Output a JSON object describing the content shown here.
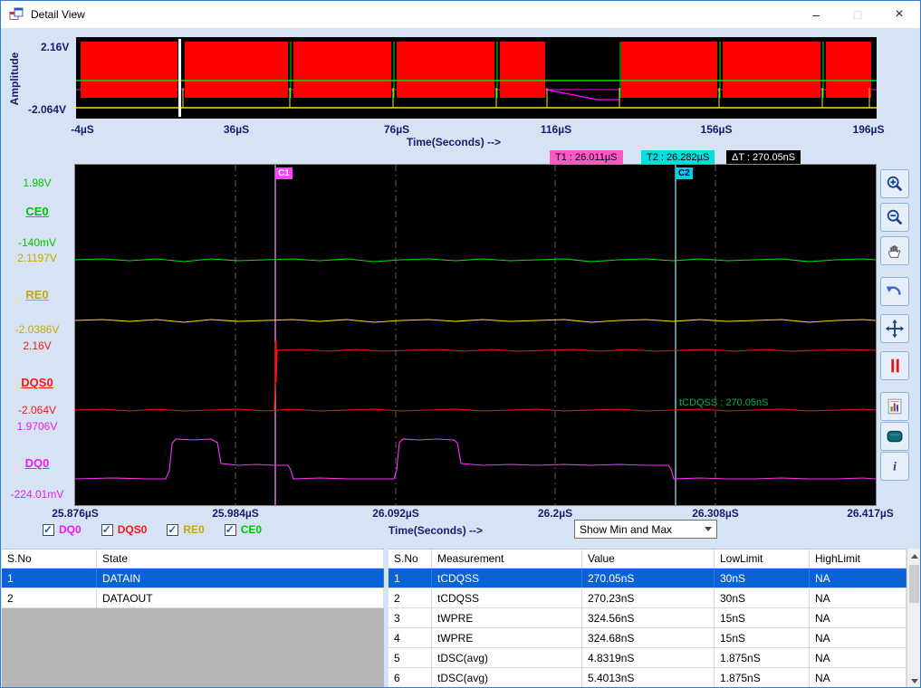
{
  "titlebar": {
    "title": "Detail View",
    "minimize_glyph": "–",
    "maximize_glyph": "□",
    "close_glyph": "×"
  },
  "overview": {
    "ylabel": "Amplitude",
    "y_max": "2.16V",
    "y_min": "-2.064V",
    "xlabel": "Time(Seconds) -->",
    "xticks": [
      "-4µS",
      "36µS",
      "76µS",
      "116µS",
      "156µS",
      "196µS"
    ]
  },
  "detail": {
    "t1": "T1 : 26.011µS",
    "t2": "T2 : 26.282µS",
    "dt": "ΔT : 270.05nS",
    "c1": "C1",
    "c2": "C2",
    "annotation": "tCDQSS : 270.05nS",
    "xlabel": "Time(Seconds) -->",
    "xticks": [
      "25.876µS",
      "25.984µS",
      "26.092µS",
      "26.2µS",
      "26.308µS",
      "26.417µS"
    ],
    "channels": [
      {
        "name": "CE0",
        "max": "1.98V",
        "min": "-140mV",
        "color": "#00e000"
      },
      {
        "name": "RE0",
        "max": "2.1197V",
        "min": "-2.0386V",
        "color": "#ffd800"
      },
      {
        "name": "DQS0",
        "max": "2.16V",
        "min": "-2.064V",
        "color": "#ff1010"
      },
      {
        "name": "DQ0",
        "max": "1.9706V",
        "min": "-224.01mV",
        "color": "#ff00ff"
      }
    ]
  },
  "toolbar": {
    "buttons": [
      "zoom-in",
      "zoom-out",
      "pan",
      "undo",
      "fit-move",
      "cursors",
      "report",
      "display",
      "info"
    ]
  },
  "legend": {
    "items": [
      {
        "label": "DQ0",
        "color": "#ff00ff",
        "checked": true
      },
      {
        "label": "DQS0",
        "color": "#ff1010",
        "checked": true
      },
      {
        "label": "RE0",
        "color": "#c9a900",
        "checked": true
      },
      {
        "label": "CE0",
        "color": "#00c400",
        "checked": true
      }
    ],
    "view_dropdown": "Show Min and Max"
  },
  "state_table": {
    "headers": [
      "S.No",
      "State"
    ],
    "rows": [
      [
        "1",
        "DATAIN"
      ],
      [
        "2",
        "DATAOUT"
      ]
    ],
    "selected_index": 0
  },
  "measurement_table": {
    "headers": [
      "S.No",
      "Measurement",
      "Value",
      "LowLimit",
      "HighLimit"
    ],
    "rows": [
      [
        "1",
        "tCDQSS",
        "270.05nS",
        "30nS",
        "NA"
      ],
      [
        "2",
        "tCDQSS",
        "270.23nS",
        "30nS",
        "NA"
      ],
      [
        "3",
        "tWPRE",
        "324.56nS",
        "15nS",
        "NA"
      ],
      [
        "4",
        "tWPRE",
        "324.68nS",
        "15nS",
        "NA"
      ],
      [
        "5",
        "tDSC(avg)",
        "4.8319nS",
        "1.875nS",
        "NA"
      ],
      [
        "6",
        "tDSC(avg)",
        "5.4013nS",
        "1.875nS",
        "NA"
      ]
    ],
    "selected_index": 0
  }
}
